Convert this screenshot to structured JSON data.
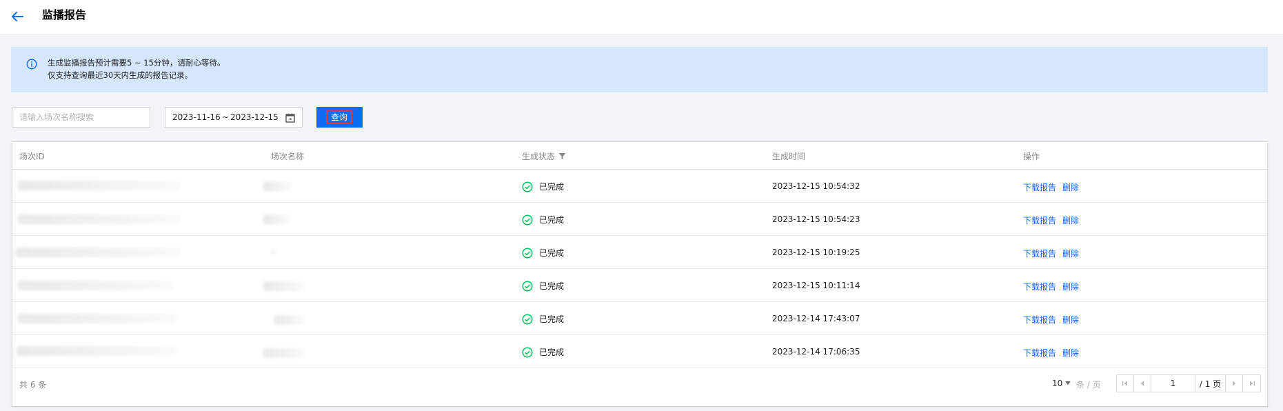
{
  "header": {
    "title": "监播报告",
    "back_icon": "arrow-left-icon"
  },
  "notice": {
    "icon": "info-icon",
    "line1": "生成监播报告预计需要5 ~ 15分钟，请耐心等待。",
    "line2": "仅支持查询最近30天内生成的报告记录。"
  },
  "filters": {
    "search_placeholder": "请输入场次名称搜索",
    "date_start": "2023-11-16",
    "date_separator": "~",
    "date_end": "2023-12-15",
    "query_label": "查询"
  },
  "table": {
    "columns": [
      "场次ID",
      "场次名称",
      "生成状态",
      "生成时间",
      "操作"
    ],
    "rows": [
      {
        "status": "已完成",
        "time": "2023-12-15 10:54:32",
        "download": "下载报告",
        "delete": "删除"
      },
      {
        "status": "已完成",
        "time": "2023-12-15 10:54:23",
        "download": "下载报告",
        "delete": "删除"
      },
      {
        "status": "已完成",
        "time": "2023-12-15 10:19:25",
        "download": "下载报告",
        "delete": "删除"
      },
      {
        "status": "已完成",
        "time": "2023-12-15 10:11:14",
        "download": "下载报告",
        "delete": "删除"
      },
      {
        "status": "已完成",
        "time": "2023-12-14 17:43:07",
        "download": "下载报告",
        "delete": "删除"
      },
      {
        "status": "已完成",
        "time": "2023-12-14 17:06:35",
        "download": "下载报告",
        "delete": "删除"
      }
    ]
  },
  "pagination": {
    "total": "共 6 条",
    "page_size": "10",
    "page_size_unit": "条 / 页",
    "current_page": "1",
    "total_pages": "/ 1 页"
  },
  "colors": {
    "primary": "#0a6df3",
    "link": "#1164e8",
    "success": "#0abf5b",
    "notice_bg": "#d5e7fd",
    "highlight_border": "#e5363b"
  }
}
